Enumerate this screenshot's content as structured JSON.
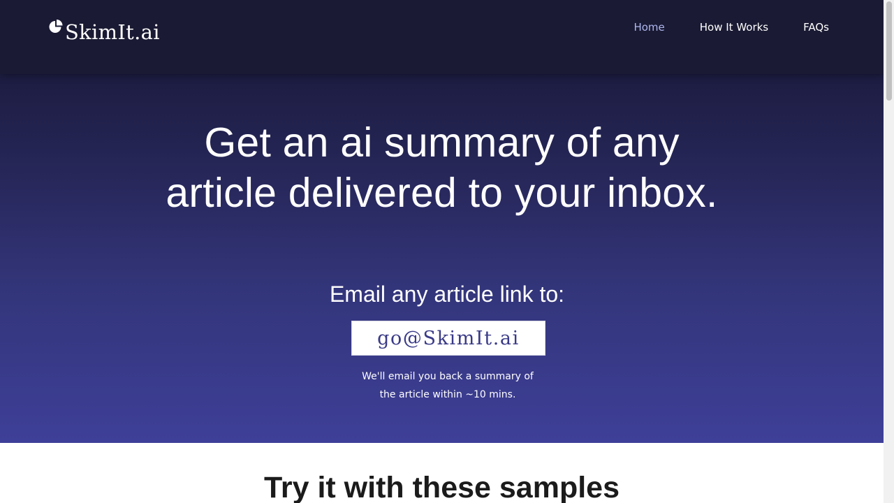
{
  "brand": {
    "name": "SkimIt.ai",
    "icon": "pie-chart-logo-icon",
    "color": "#ffffff"
  },
  "nav": {
    "items": [
      {
        "label": "Home",
        "active": true
      },
      {
        "label": "How It Works",
        "active": false
      },
      {
        "label": "FAQs",
        "active": false
      }
    ],
    "active_color": "#aeb6ee"
  },
  "hero": {
    "headline_line1": "Get an ai summary of any",
    "headline_line2": "article delivered to your inbox.",
    "cta_label": "Email any article link to:",
    "email": "go@SkimIt.ai",
    "note_line1": "We'll email you back a summary of",
    "note_line2": "the article within ~10 mins.",
    "gradient_top": "#181833",
    "gradient_bottom": "#3e3f98"
  },
  "samples": {
    "heading": "Try it with these samples"
  }
}
